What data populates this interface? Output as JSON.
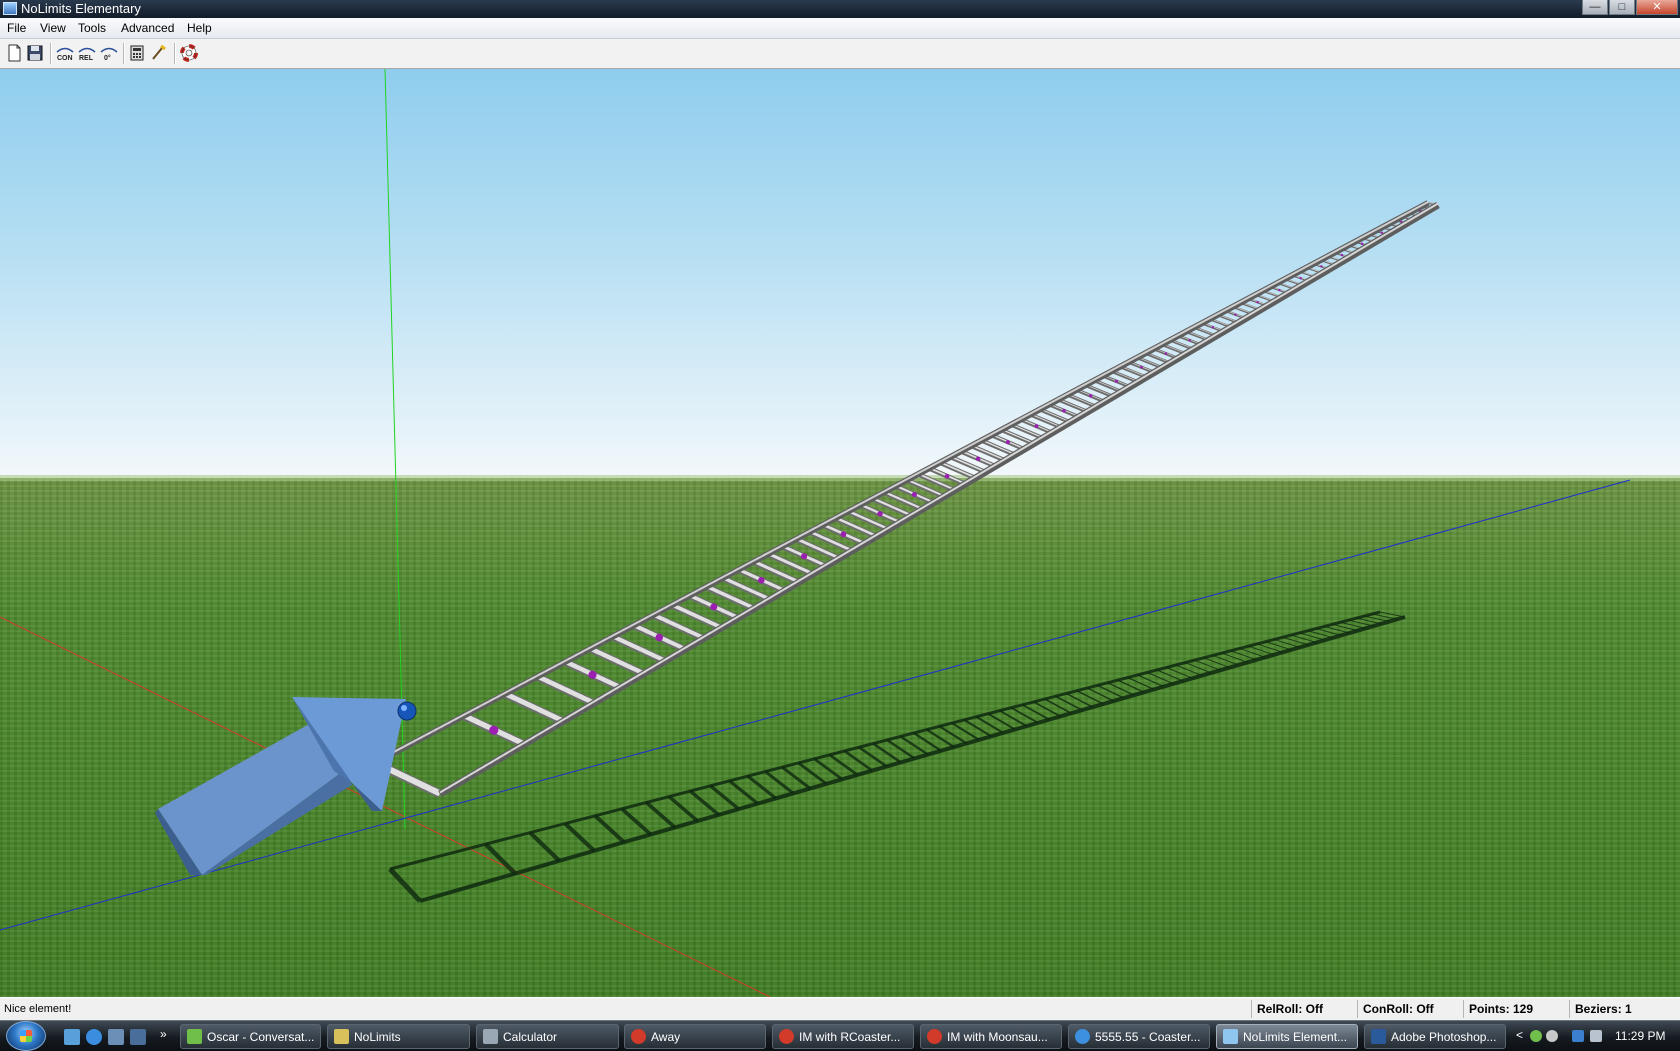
{
  "window": {
    "title": "NoLimits Elementary"
  },
  "menu": [
    "File",
    "View",
    "Tools",
    "Advanced",
    "Help"
  ],
  "toolbar": [
    {
      "icon": "new-file-icon"
    },
    {
      "icon": "save-icon"
    },
    {
      "icon": "con-roll-icon",
      "label": "CON"
    },
    {
      "icon": "rel-roll-icon",
      "label": "REL"
    },
    {
      "icon": "zero-roll-icon",
      "label": "0°"
    },
    {
      "icon": "calculator-icon"
    },
    {
      "icon": "edit-tool-icon"
    },
    {
      "icon": "lifebuoy-icon"
    }
  ],
  "status": {
    "message": "Nice element!",
    "relroll": "RelRoll: Off",
    "conroll": "ConRoll: Off",
    "points": "Points: 129",
    "beziers": "Beziers: 1"
  },
  "taskbar": {
    "items": [
      {
        "label": "Oscar - Conversat...",
        "icon": "chat-icon",
        "color": "#6fbf4a"
      },
      {
        "label": "NoLimits",
        "icon": "folder-icon",
        "color": "#d8c15a"
      },
      {
        "label": "Calculator",
        "icon": "calculator-icon",
        "color": "#9aa7b5"
      },
      {
        "label": "Away",
        "icon": "im-icon",
        "color": "#d23a2a"
      },
      {
        "label": "IM with RCoaster...",
        "icon": "im-icon",
        "color": "#d23a2a"
      },
      {
        "label": "IM with Moonsau...",
        "icon": "im-icon",
        "color": "#d23a2a"
      },
      {
        "label": "5555.55 - Coaster...",
        "icon": "ie-icon",
        "color": "#3d8fe0"
      },
      {
        "label": "NoLimits Element...",
        "icon": "nolimits-icon",
        "color": "#8ec6ef",
        "active": true
      },
      {
        "label": "Adobe Photoshop...",
        "icon": "photoshop-icon",
        "color": "#2a5a9a"
      }
    ],
    "clock": "11:29 PM"
  },
  "colors": {
    "sky_top": "#8fcdee",
    "grass": "#4f8a2f",
    "rail": "#9a9a9a",
    "tie": "#e0e0e0",
    "node": "#9b1fb0",
    "arrow": "#6b9ad6",
    "axis_x": "#d43a2a",
    "axis_y": "#21d421",
    "axis_z": "#1c2fd0"
  }
}
